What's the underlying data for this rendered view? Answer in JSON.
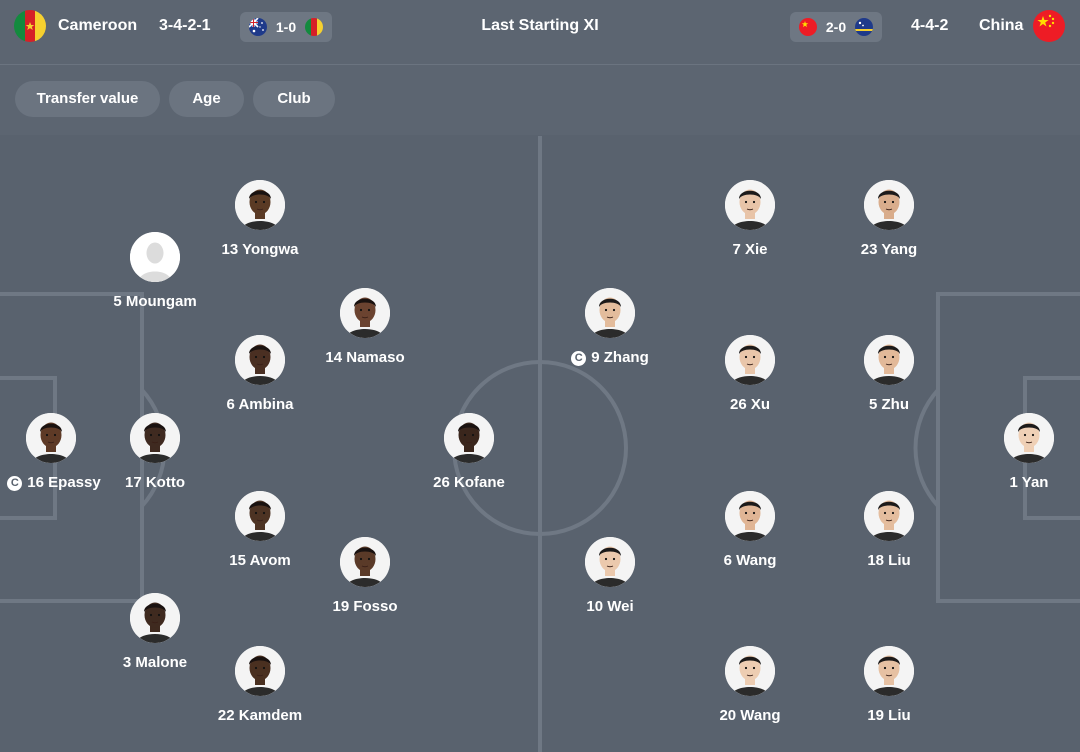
{
  "header": {
    "title": "Last Starting XI",
    "home_team": "Cameroon",
    "home_formation": "3-4-2-1",
    "home_last_score": "1-0",
    "away_team": "China",
    "away_formation": "4-4-2",
    "away_last_score": "2-0"
  },
  "filters": [
    "Transfer value",
    "Age",
    "Club"
  ],
  "colors": {
    "background": "#59626e",
    "header": "#5c6571",
    "chip": "#6b7480",
    "pitch_lines": "#6f7884",
    "text": "#ffffff"
  },
  "home_players": [
    {
      "label": "13 Yongwa",
      "captain": false,
      "skin": "#5a3a24"
    },
    {
      "label": "5 Moungam",
      "captain": false,
      "skin": "placeholder"
    },
    {
      "label": "14 Namaso",
      "captain": false,
      "skin": "#6b4330"
    },
    {
      "label": "6 Ambina",
      "captain": false,
      "skin": "#4a2f22"
    },
    {
      "label": "16 Epassy",
      "captain": true,
      "skin": "#5e3a26"
    },
    {
      "label": "17 Kotto",
      "captain": false,
      "skin": "#3f2a20"
    },
    {
      "label": "26 Kofane",
      "captain": false,
      "skin": "#3a261c"
    },
    {
      "label": "15 Avom",
      "captain": false,
      "skin": "#4d3323"
    },
    {
      "label": "19 Fosso",
      "captain": false,
      "skin": "#5a3a28"
    },
    {
      "label": "3 Malone",
      "captain": false,
      "skin": "#3f2a1f"
    },
    {
      "label": "22 Kamdem",
      "captain": false,
      "skin": "#4a3020"
    }
  ],
  "away_players": [
    {
      "label": "7 Xie",
      "captain": false,
      "skin": "#e8c4a8"
    },
    {
      "label": "23 Yang",
      "captain": false,
      "skin": "#d9ad8c"
    },
    {
      "label": "9 Zhang",
      "captain": true,
      "skin": "#e3bc9c"
    },
    {
      "label": "26 Xu",
      "captain": false,
      "skin": "#e9c6aa"
    },
    {
      "label": "5 Zhu",
      "captain": false,
      "skin": "#e2b999"
    },
    {
      "label": "1 Yan",
      "captain": false,
      "skin": "#efd0b6"
    },
    {
      "label": "10 Wei",
      "captain": false,
      "skin": "#ebc9ad"
    },
    {
      "label": "6 Wang",
      "captain": false,
      "skin": "#e0b595"
    },
    {
      "label": "18 Liu",
      "captain": false,
      "skin": "#e4bd9e"
    },
    {
      "label": "20 Wang",
      "captain": false,
      "skin": "#edcdb2"
    },
    {
      "label": "19 Liu",
      "captain": false,
      "skin": "#e6c1a3"
    }
  ]
}
